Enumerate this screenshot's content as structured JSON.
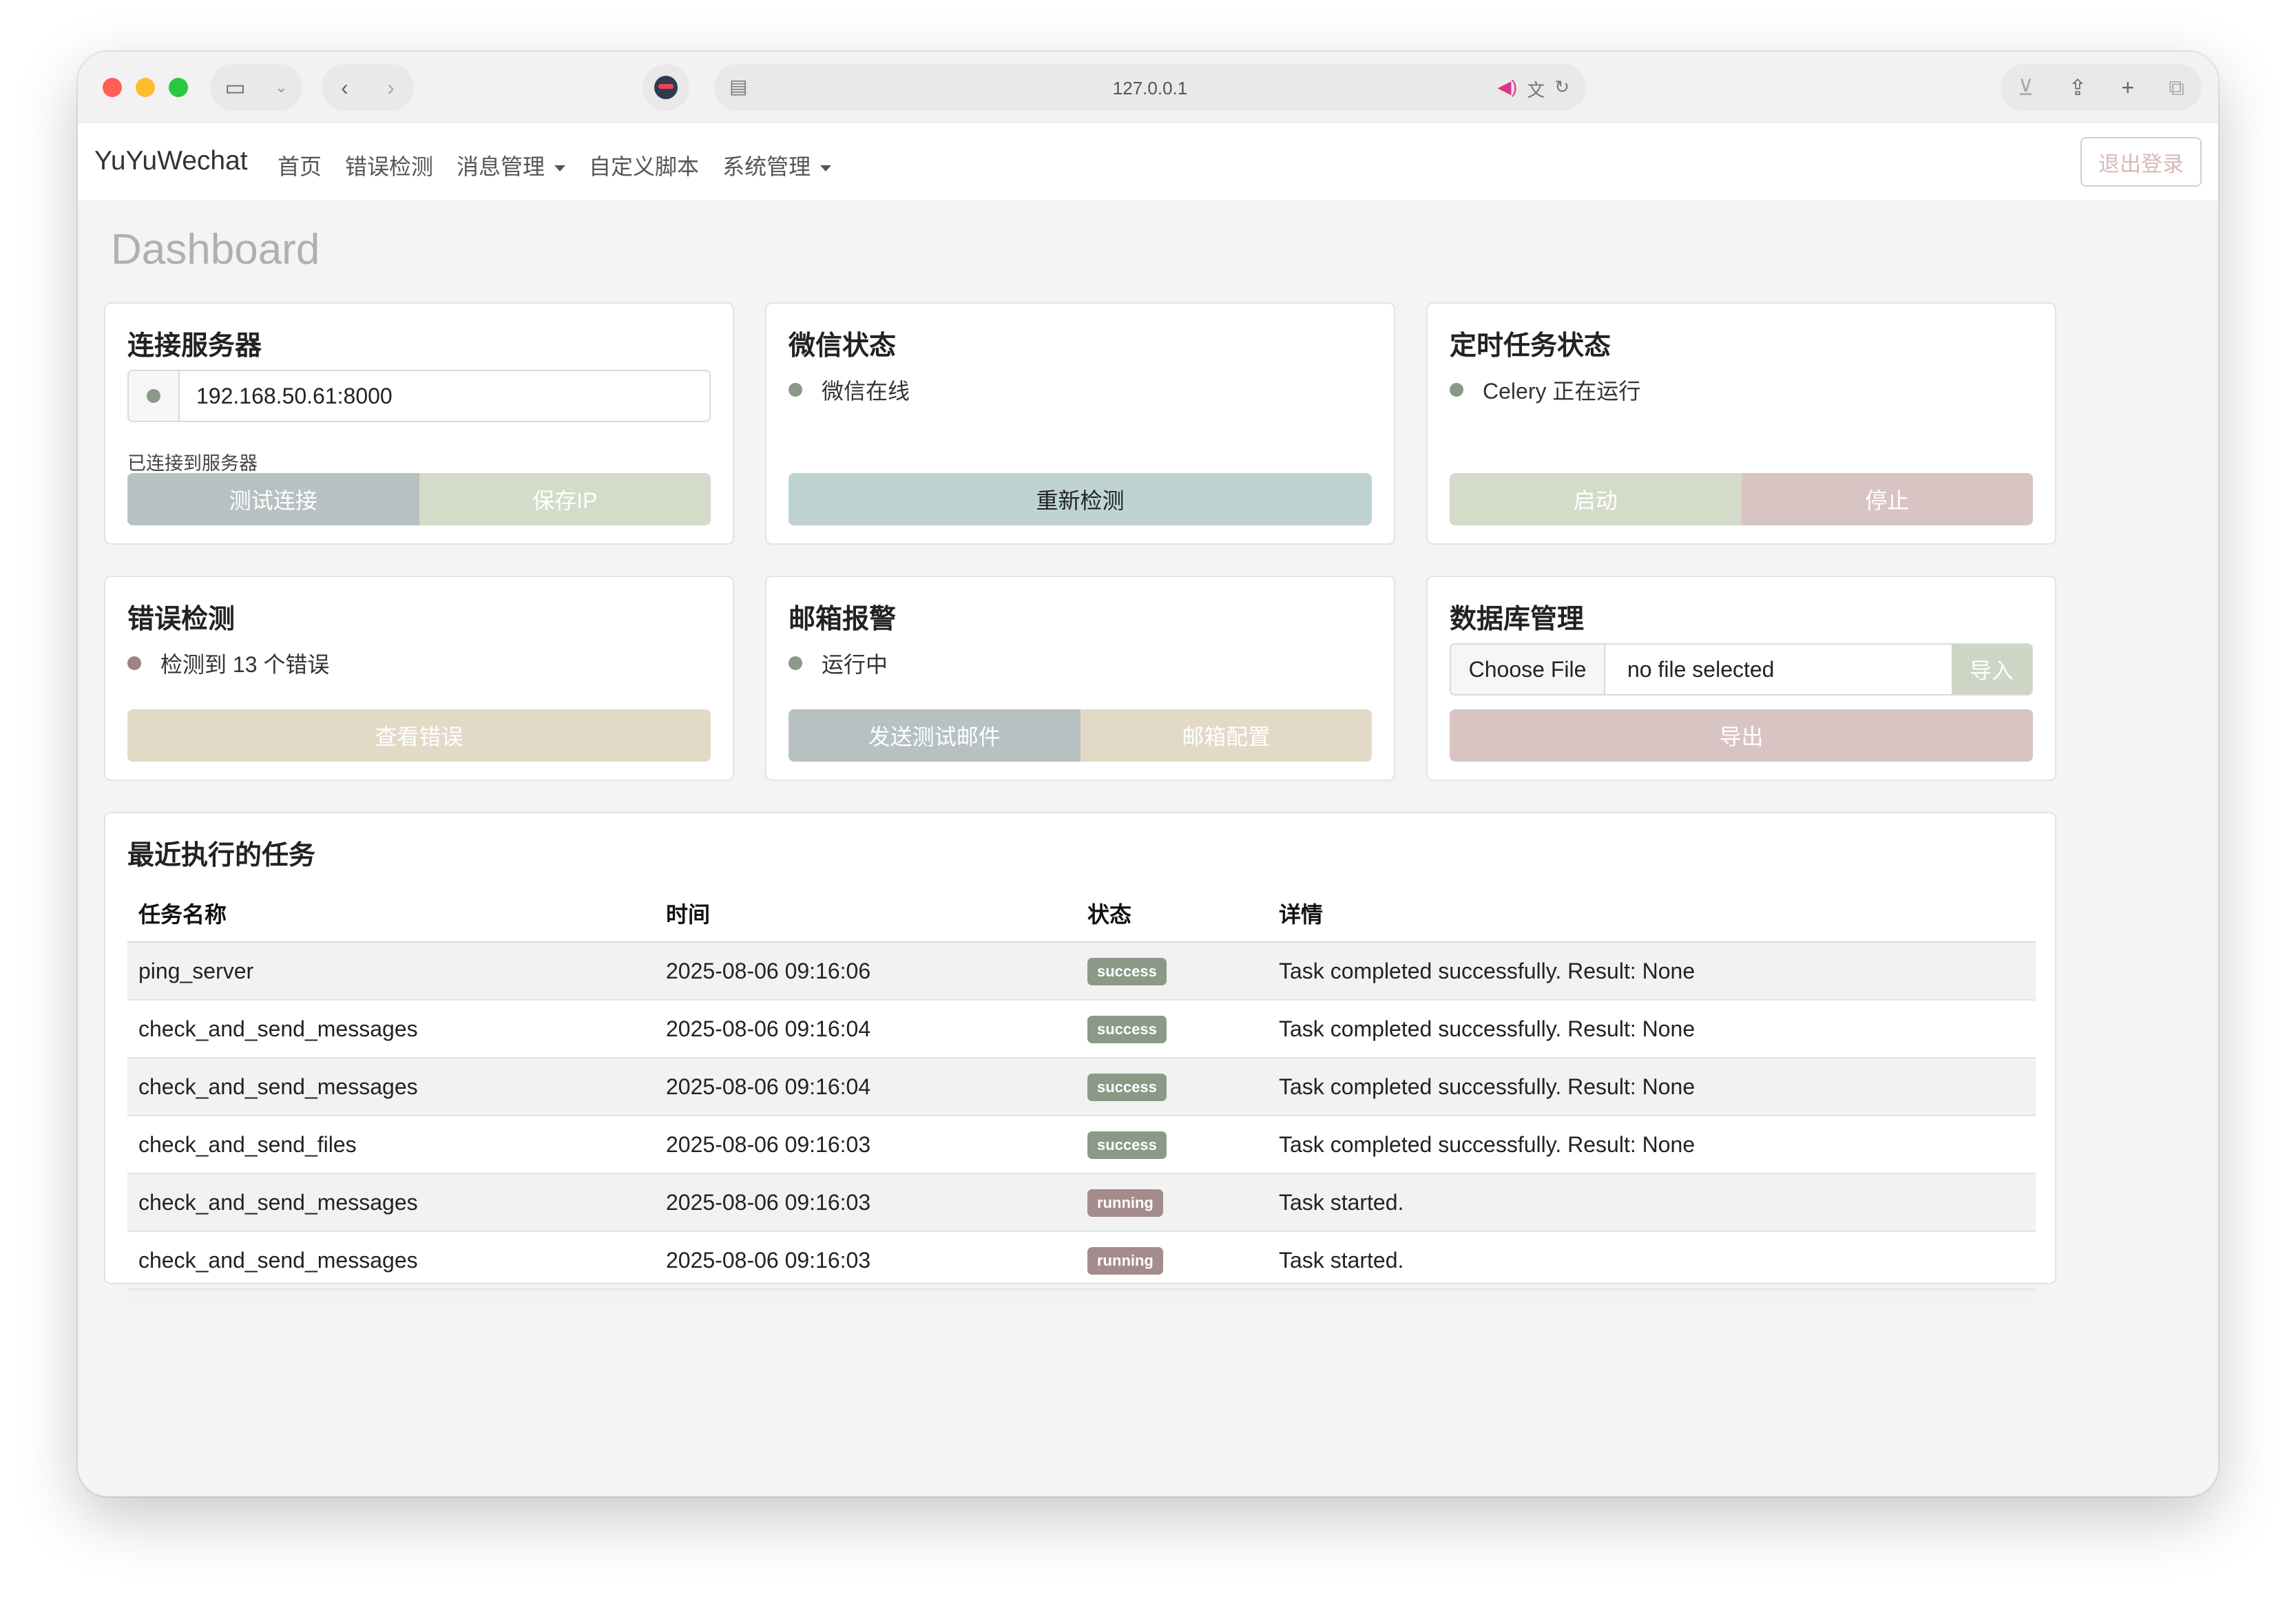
{
  "browser": {
    "url": "127.0.0.1"
  },
  "navbar": {
    "brand": "YuYuWechat",
    "links": [
      {
        "label": "首页",
        "dropdown": false
      },
      {
        "label": "错误检测",
        "dropdown": false
      },
      {
        "label": "消息管理",
        "dropdown": true
      },
      {
        "label": "自定义脚本",
        "dropdown": false
      },
      {
        "label": "系统管理",
        "dropdown": true
      }
    ],
    "logout_label": "退出登录"
  },
  "page_title": "Dashboard",
  "colors": {
    "status_green": "#8a9a8a",
    "status_red": "#a08282",
    "btn_gray_blue": "#b7c1c1",
    "btn_sage": "#d4dbc9",
    "btn_teal": "#bfd3d3",
    "btn_rose": "#d9c4c4",
    "btn_beige": "#e2dac7",
    "badge_success": "#8a9a86",
    "badge_running": "#a58c8c"
  },
  "cards": {
    "server": {
      "title": "连接服务器",
      "ip_value": "192.168.50.61:8000",
      "note": "已连接到服务器",
      "test_label": "测试连接",
      "save_label": "保存IP"
    },
    "wechat": {
      "title": "微信状态",
      "status": "微信在线",
      "recheck_label": "重新检测"
    },
    "cron": {
      "title": "定时任务状态",
      "status": "Celery 正在运行",
      "start_label": "启动",
      "stop_label": "停止"
    },
    "errors": {
      "title": "错误检测",
      "status": "检测到 13 个错误",
      "view_label": "查看错误"
    },
    "mail": {
      "title": "邮箱报警",
      "status": "运行中",
      "send_label": "发送测试邮件",
      "config_label": "邮箱配置"
    },
    "db": {
      "title": "数据库管理",
      "choose_label": "Choose File",
      "file_status": "no file selected",
      "import_label": "导入",
      "export_label": "导出"
    }
  },
  "tasks": {
    "title": "最近执行的任务",
    "columns": [
      "任务名称",
      "时间",
      "状态",
      "详情"
    ],
    "rows": [
      {
        "name": "ping_server",
        "time": "2025-08-06 09:16:06",
        "status": "success",
        "detail": "Task completed successfully. Result: None"
      },
      {
        "name": "check_and_send_messages",
        "time": "2025-08-06 09:16:04",
        "status": "success",
        "detail": "Task completed successfully. Result: None"
      },
      {
        "name": "check_and_send_messages",
        "time": "2025-08-06 09:16:04",
        "status": "success",
        "detail": "Task completed successfully. Result: None"
      },
      {
        "name": "check_and_send_files",
        "time": "2025-08-06 09:16:03",
        "status": "success",
        "detail": "Task completed successfully. Result: None"
      },
      {
        "name": "check_and_send_messages",
        "time": "2025-08-06 09:16:03",
        "status": "running",
        "detail": "Task started."
      },
      {
        "name": "check_and_send_messages",
        "time": "2025-08-06 09:16:03",
        "status": "running",
        "detail": "Task started."
      }
    ]
  }
}
